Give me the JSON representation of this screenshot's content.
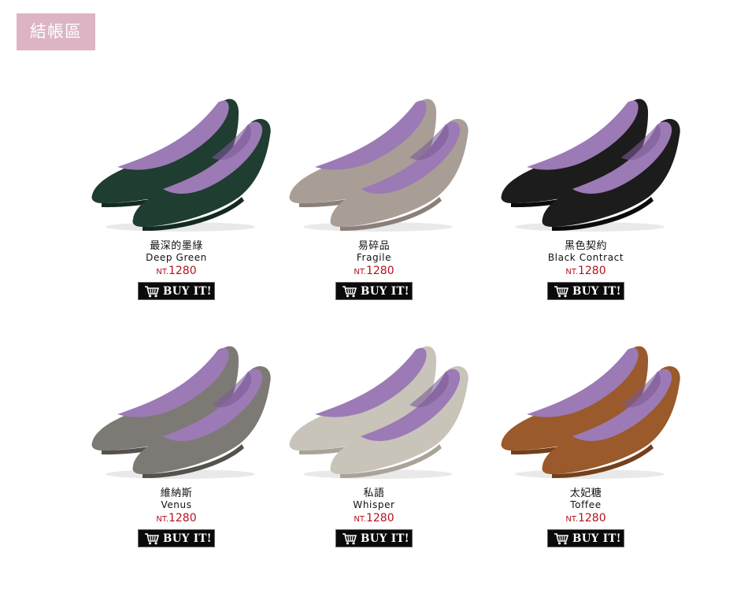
{
  "header": {
    "checkout_label": "結帳區"
  },
  "products": [
    {
      "name_zh": "最深的墨綠",
      "name_en": "Deep Green",
      "currency": "NT.",
      "price": "1280",
      "buy_label": "BUY IT!",
      "color": "#1f3d31",
      "shade": "#132a21"
    },
    {
      "name_zh": "易碎品",
      "name_en": "Fragile",
      "currency": "NT.",
      "price": "1280",
      "buy_label": "BUY IT!",
      "color": "#a99e96",
      "shade": "#8b8079"
    },
    {
      "name_zh": "黑色契約",
      "name_en": "Black Contract",
      "currency": "NT.",
      "price": "1280",
      "buy_label": "BUY IT!",
      "color": "#1c1c1c",
      "shade": "#0b0b0b"
    },
    {
      "name_zh": "維納斯",
      "name_en": "Venus",
      "currency": "NT.",
      "price": "1280",
      "buy_label": "BUY IT!",
      "color": "#7d7a75",
      "shade": "#55524e"
    },
    {
      "name_zh": "私語",
      "name_en": "Whisper",
      "currency": "NT.",
      "price": "1280",
      "buy_label": "BUY IT!",
      "color": "#c9c4ba",
      "shade": "#a9a398"
    },
    {
      "name_zh": "太妃糖",
      "name_en": "Toffee",
      "currency": "NT.",
      "price": "1280",
      "buy_label": "BUY IT!",
      "color": "#9a5a2b",
      "shade": "#74401c"
    }
  ],
  "colors": {
    "insole": "#9c7ab5",
    "insole_dark": "#7b5a96",
    "price": "#b3121e",
    "badge": "#dcb4c6"
  }
}
